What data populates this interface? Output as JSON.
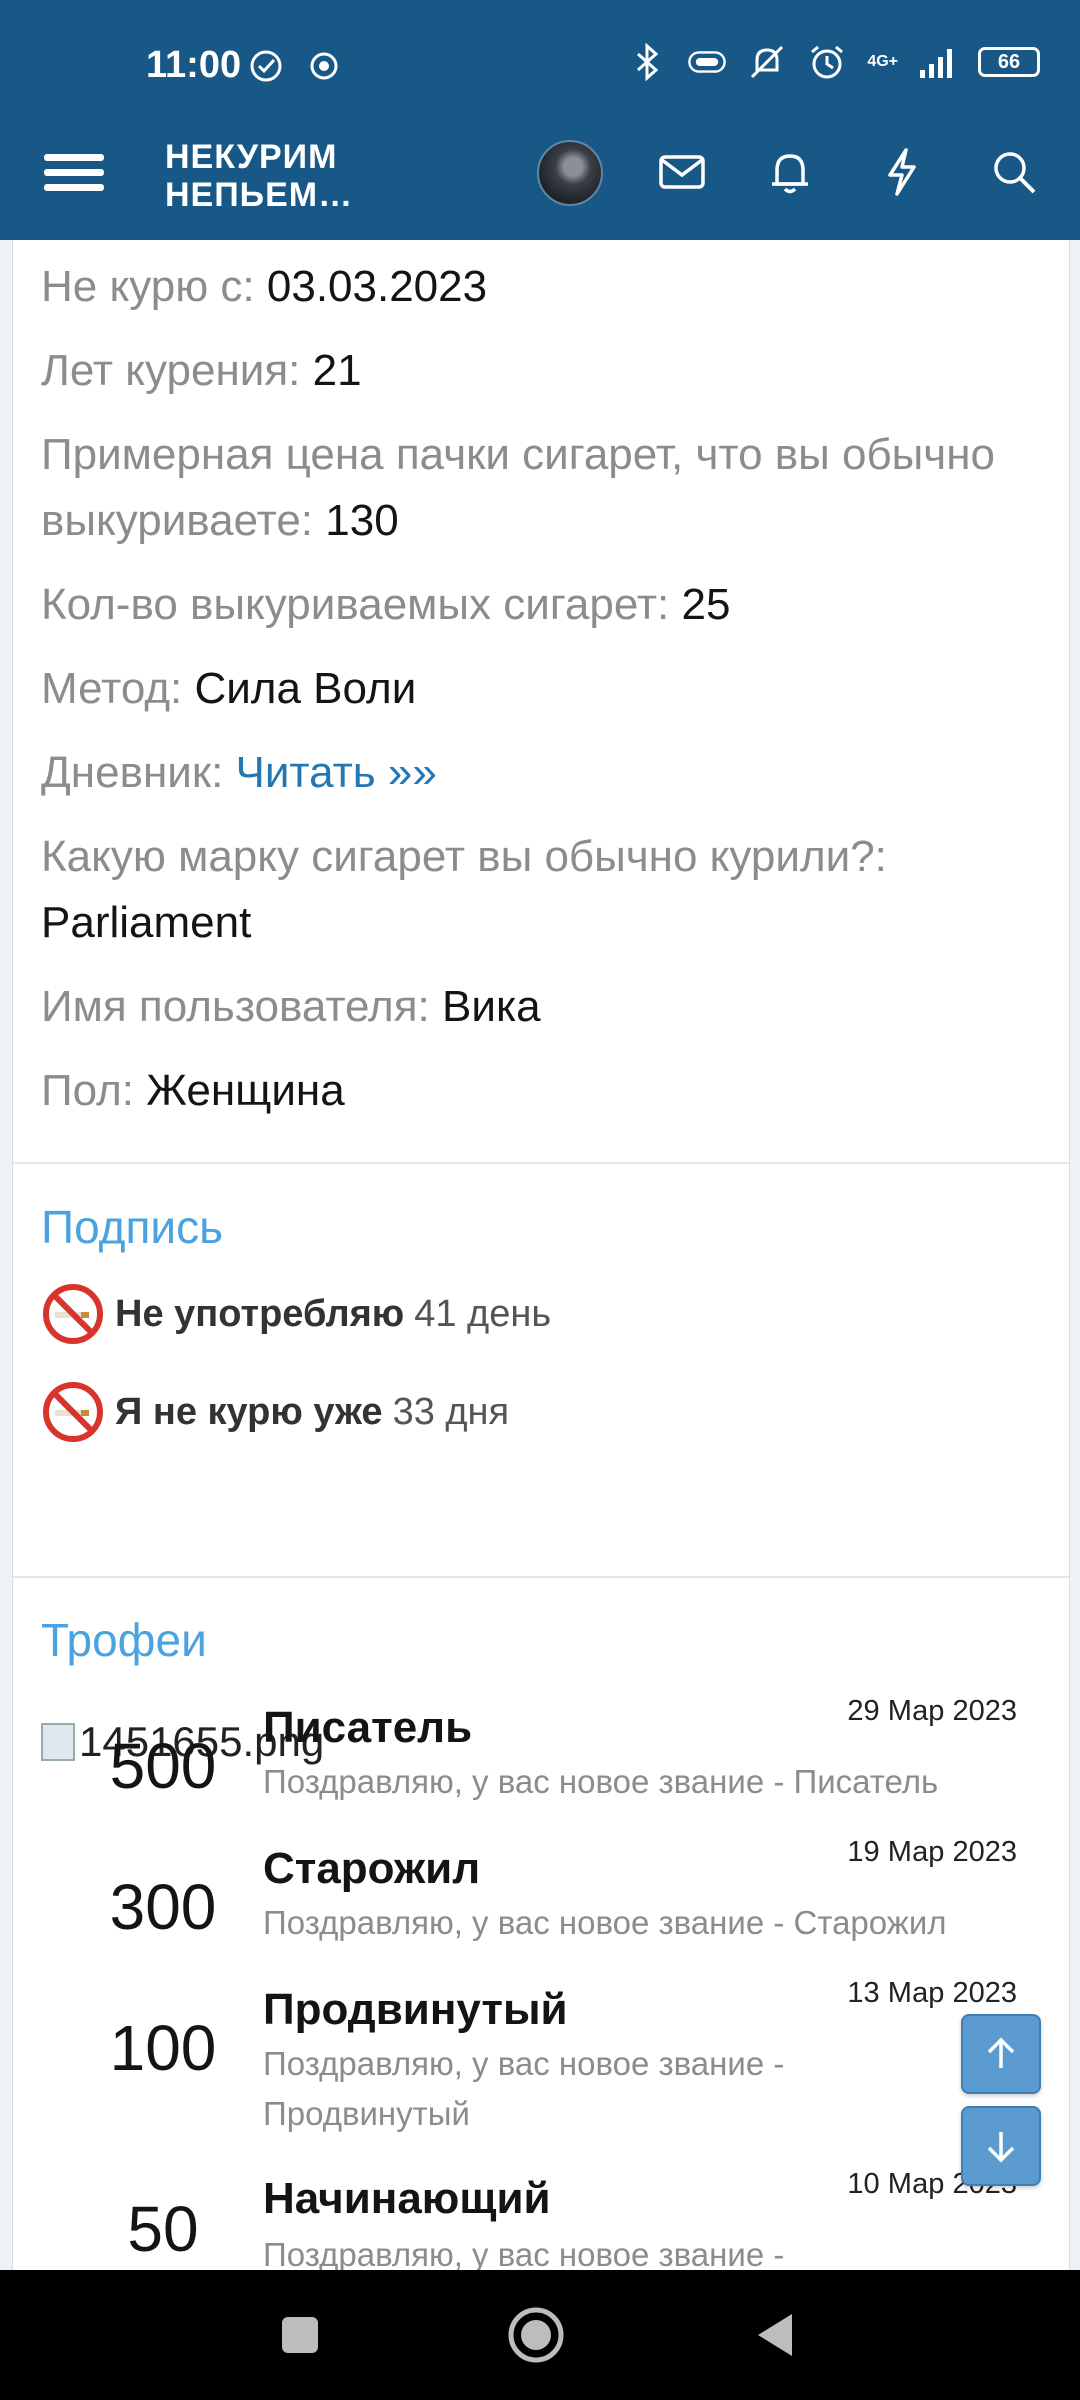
{
  "status_bar": {
    "time": "11:00",
    "network_label": "4G+",
    "battery": "66"
  },
  "header": {
    "logo_line1": "НЕКУРИМ",
    "logo_line2": "НЕПЬЕМ…"
  },
  "profile_fields": [
    {
      "label": "Не курю с: ",
      "value": "03.03.2023"
    },
    {
      "label": "Лет курения: ",
      "value": "21"
    },
    {
      "label": "Примерная цена пачки сигарет, что вы обычно выкуриваете: ",
      "value": "130"
    },
    {
      "label": "Кол-во выкуриваемых сигарет: ",
      "value": "25"
    },
    {
      "label": "Метод: ",
      "value": "Сила Воли"
    },
    {
      "label": "Дневник: ",
      "link": "Читать »»"
    },
    {
      "label": "Какую марку сигарет вы обычно курили?: ",
      "value": "Parliament"
    },
    {
      "label": "Имя пользователя: ",
      "value": "Вика"
    },
    {
      "label": "Пол: ",
      "value": "Женщина"
    }
  ],
  "signature": {
    "title": "Подпись",
    "lines": [
      {
        "text": "Не употребляю",
        "count": "41 день"
      },
      {
        "text": "Я не курю уже",
        "count": "33 дня"
      }
    ],
    "image_alt": "1451655.png"
  },
  "trophies": {
    "title": "Трофеи",
    "items": [
      {
        "points": "500",
        "title": "Писатель",
        "date": "29 Мар 2023",
        "desc": "Поздравляю, у вас новое звание - Писатель"
      },
      {
        "points": "300",
        "title": "Старожил",
        "date": "19 Мар 2023",
        "desc": "Поздравляю, у вас новое звание - Старожил"
      },
      {
        "points": "100",
        "title": "Продвинутый",
        "date": "13 Мар 2023",
        "desc": "Поздравляю, у вас новое звание - Продвинутый"
      },
      {
        "points": "50",
        "title": "Начинающий",
        "date": "10 Мар 2023",
        "desc": "Поздравляю, у вас новое звание -"
      }
    ]
  },
  "colors": {
    "header_bg": "#185886",
    "link": "#2577b1",
    "section_title": "#4aa3df"
  }
}
